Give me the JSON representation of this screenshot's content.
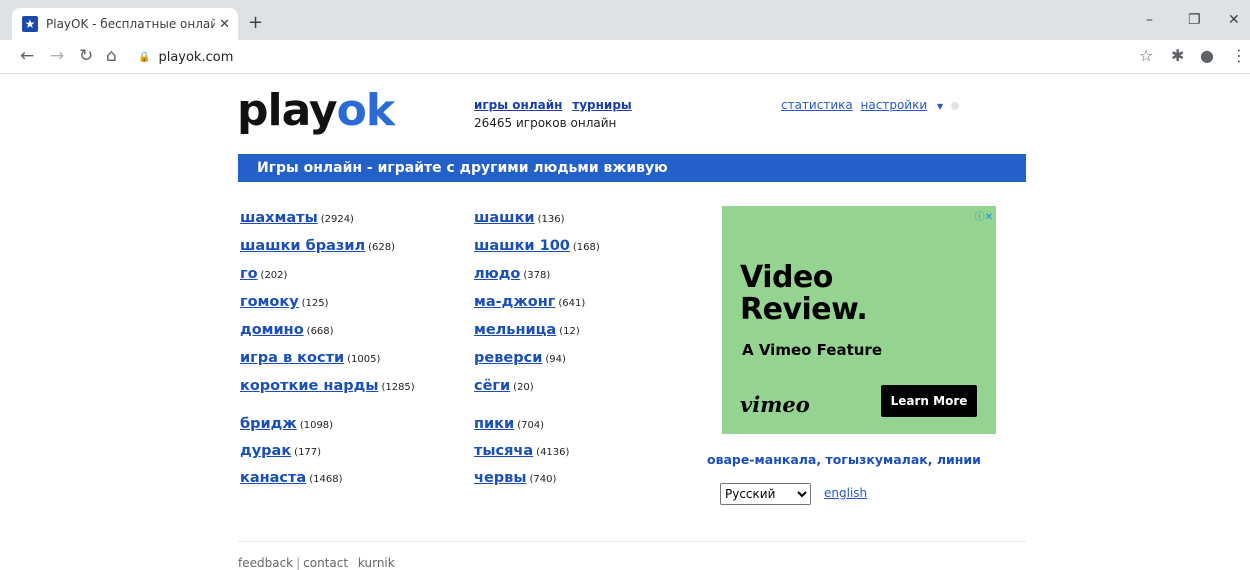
{
  "browser": {
    "tab_title": "PlayOK - бесплатные онлайн иг",
    "tab_close": "✕",
    "new_tab": "+",
    "url": "playok.com",
    "win_minimize": "–",
    "win_restore": "❐",
    "win_close": "✕",
    "back": "←",
    "forward": "→",
    "reload": "↻",
    "home": "⌂",
    "star": "☆",
    "extensions": "✱",
    "profile": "●",
    "menu": "⋮"
  },
  "header": {
    "logo_part1": "play",
    "logo_part2": "ok",
    "link_games": "игры онлайн",
    "link_tournaments": "турниры",
    "online_count": "26465 игроков онлайн",
    "link_stats": "статистика",
    "link_settings": "настройки",
    "caret": "▼"
  },
  "banner": {
    "text": "Игры онлайн - играйте с другими людьми вживую"
  },
  "games_left": [
    {
      "name": "шахматы",
      "count": "(2924)"
    },
    {
      "name": "шашки бразил",
      "count": "(628)"
    },
    {
      "name": "го",
      "count": "(202)"
    },
    {
      "name": "гомоку",
      "count": "(125)"
    },
    {
      "name": "домино",
      "count": "(668)"
    },
    {
      "name": "игра в кости",
      "count": "(1005)"
    },
    {
      "name": "короткие нарды",
      "count": "(1285)"
    },
    {
      "name": "бридж",
      "count": "(1098)"
    },
    {
      "name": "дурак",
      "count": "(177)"
    },
    {
      "name": "канаста",
      "count": "(1468)"
    }
  ],
  "games_right": [
    {
      "name": "шашки",
      "count": "(136)"
    },
    {
      "name": "шашки 100",
      "count": "(168)"
    },
    {
      "name": "людо",
      "count": "(378)"
    },
    {
      "name": "ма-джонг",
      "count": "(641)"
    },
    {
      "name": "мельница",
      "count": "(12)"
    },
    {
      "name": "реверси",
      "count": "(94)"
    },
    {
      "name": "сёги",
      "count": "(20)"
    },
    {
      "name": "пики",
      "count": "(704)"
    },
    {
      "name": "тысяча",
      "count": "(4136)"
    },
    {
      "name": "червы",
      "count": "(740)"
    }
  ],
  "ad": {
    "info": "ⓘ✕",
    "headline_line1": "Video",
    "headline_line2": "Review.",
    "subline": "A Vimeo Feature",
    "brand": "vimeo",
    "cta": "Learn More"
  },
  "more_games": {
    "text1": "оваре-манкала",
    "sep1": ", ",
    "text2": "тогызкумалак",
    "sep2": ", ",
    "text3": "линии"
  },
  "language": {
    "selected": "Русский",
    "alt_link": "english"
  },
  "footer": {
    "feedback": "feedback",
    "sep": "|",
    "contact": "contact",
    "kurnik": "kurnik"
  }
}
